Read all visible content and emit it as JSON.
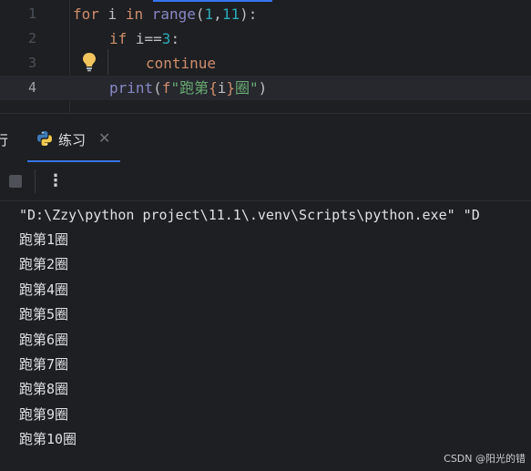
{
  "editor": {
    "line_numbers": [
      "1",
      "2",
      "3",
      "4"
    ],
    "line1": {
      "kw_for": "for",
      "var_i": " i ",
      "kw_in": "in",
      "sp": " ",
      "fn_range": "range",
      "open": "(",
      "n1": "1",
      "comma": ",",
      "n11": "11",
      "close": "):"
    },
    "line2": {
      "kw_if": "if",
      "cond": " i==",
      "n3": "3",
      "colon": ":"
    },
    "line3": {
      "kw_continue": "continue"
    },
    "line4": {
      "fn_print": "print",
      "open": "(",
      "prefix": "f",
      "str_open": "\"跑第",
      "brace_open": "{",
      "var_i": "i",
      "brace_close": "}",
      "str_close": "圈\"",
      "close": ")"
    }
  },
  "tool_window": {
    "left_tab_partial": "行",
    "active_tab_label": "练习",
    "close_glyph": "✕"
  },
  "toolbar": {
    "more_glyph": "⋮"
  },
  "console": {
    "command": "\"D:\\Zzy\\python project\\11.1\\.venv\\Scripts\\python.exe\" \"D",
    "output": [
      "跑第1圈",
      "跑第2圈",
      "跑第4圈",
      "跑第5圈",
      "跑第6圈",
      "跑第7圈",
      "跑第8圈",
      "跑第9圈",
      "跑第10圈"
    ]
  },
  "watermark": "CSDN @阳光的错",
  "colors": {
    "background": "#1e1f22",
    "keyword": "#cf8e6d",
    "builtin": "#8888c6",
    "number": "#2aacb8",
    "string": "#6aab73",
    "accent": "#3574f0"
  },
  "icons": {
    "bulb": "lightbulb-icon",
    "python": "python-icon",
    "close": "close-icon",
    "stop": "stop-icon",
    "more": "more-vertical-icon"
  }
}
